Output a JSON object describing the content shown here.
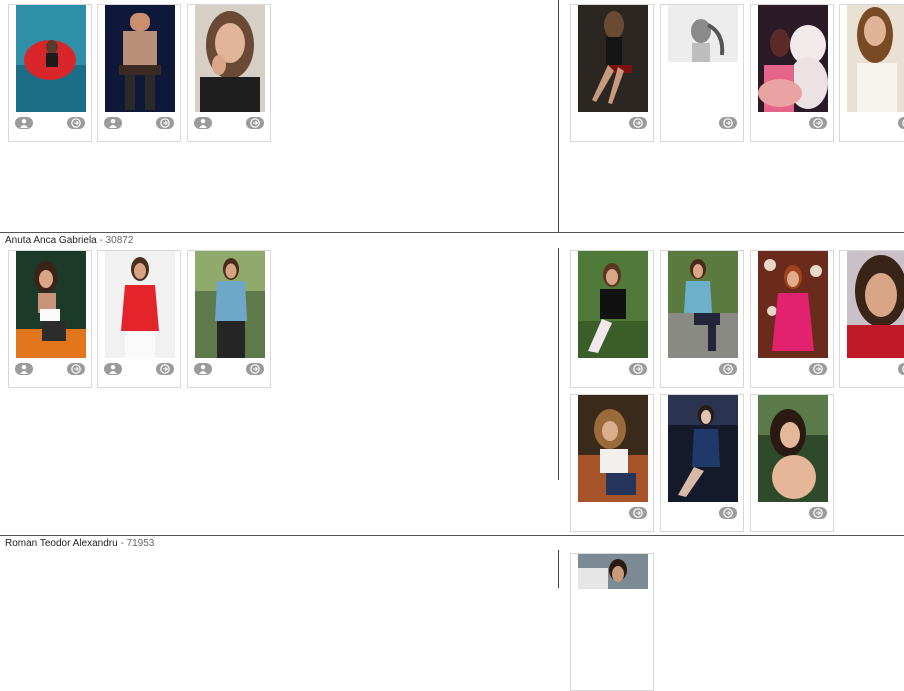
{
  "rows": [
    {
      "name": "",
      "separator": "",
      "id": ""
    },
    {
      "name": "Anuta Anca Gabriela",
      "separator": " - ",
      "id": "30872"
    },
    {
      "name": "Roman Teodor Alexandru",
      "separator": " - ",
      "id": "71953"
    }
  ],
  "icons": {
    "profile": "user-icon",
    "open": "arrow-circle-icon"
  },
  "colors": {
    "button_bg": "#9b9b9b",
    "card_border": "#d8d8d8",
    "divider": "#444444"
  }
}
